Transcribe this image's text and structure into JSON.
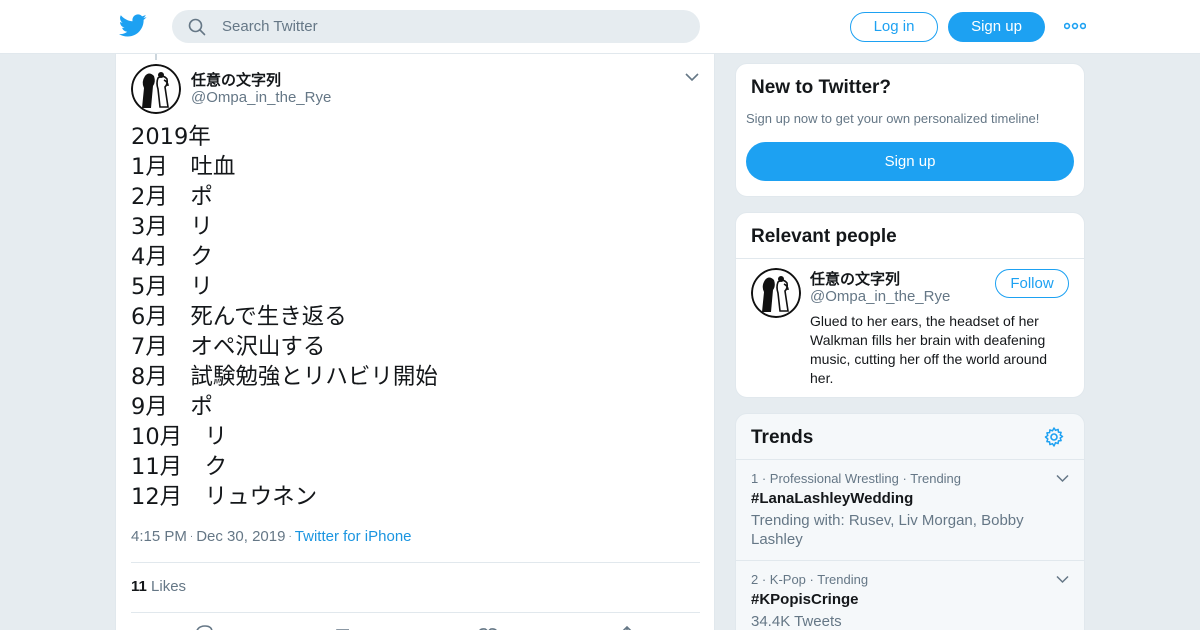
{
  "search": {
    "placeholder": "Search Twitter"
  },
  "header": {
    "login_label": "Log in",
    "signup_label": "Sign up"
  },
  "tweet": {
    "author_name": "任意の文字列",
    "author_handle": "@Ompa_in_the_Rye",
    "text": "2019年\n1月　吐血\n2月　ポ\n3月　リ\n4月　ク\n5月　リ\n6月　死んで生き返る\n7月　オペ沢山する\n8月　試験勉強とリハビリ開始\n9月　ポ\n10月　リ\n11月　ク\n12月　リュウネン",
    "time": "4:15 PM",
    "date": "Dec 30, 2019",
    "source": "Twitter for iPhone",
    "likes_count": "11",
    "likes_label": "Likes"
  },
  "new_to_twitter": {
    "title": "New to Twitter?",
    "subtitle": "Sign up now to get your own personalized timeline!",
    "signup_label": "Sign up"
  },
  "relevant_people": {
    "title": "Relevant people",
    "name": "任意の文字列",
    "handle": "@Ompa_in_the_Rye",
    "follow_label": "Follow",
    "bio": "Glued to her ears, the headset of her Walkman fills her brain with deafening music, cutting her off the world around her."
  },
  "trends": {
    "title": "Trends",
    "items": [
      {
        "context": "1 · Professional Wrestling · Trending",
        "tag": "#LanaLashleyWedding",
        "extra": "Trending with: Rusev, Liv Morgan, Bobby Lashley"
      },
      {
        "context": "2 · K-Pop · Trending",
        "tag": "#KPopisCringe",
        "extra": "34.4K Tweets"
      }
    ]
  },
  "icons": {
    "logo": "twitter-bird-icon",
    "search": "search-icon",
    "more": "more-icon",
    "caret": "chevron-down-icon",
    "settings": "gear-icon",
    "actions": [
      "reply-icon",
      "retweet-icon",
      "like-icon",
      "share-icon"
    ]
  },
  "colors": {
    "brand": "#1da1f2",
    "link": "#1b95e0",
    "secondary_text": "#657786"
  }
}
